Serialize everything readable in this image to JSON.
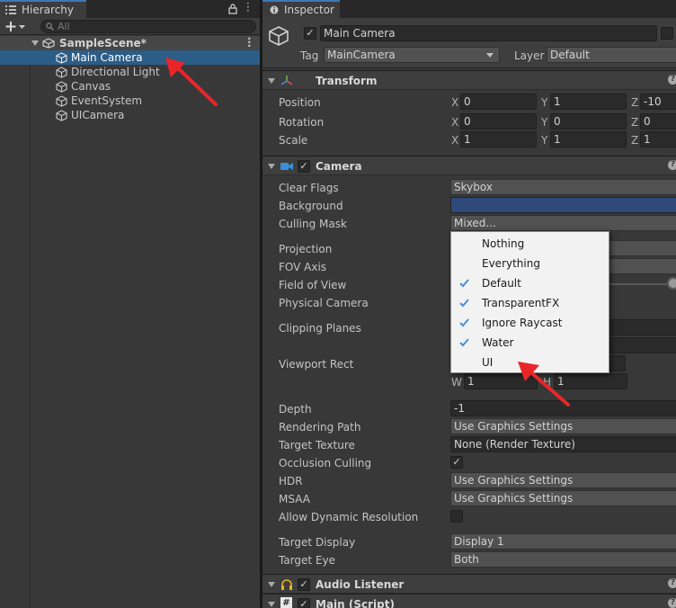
{
  "hierarchy": {
    "tab_label": "Hierarchy",
    "search_placeholder": "All",
    "scene_name": "SampleScene*",
    "items": [
      {
        "label": "Main Camera",
        "selected": true
      },
      {
        "label": "Directional Light",
        "selected": false
      },
      {
        "label": "Canvas",
        "selected": false
      },
      {
        "label": "EventSystem",
        "selected": false
      },
      {
        "label": "UICamera",
        "selected": false
      }
    ]
  },
  "inspector": {
    "tab_label": "Inspector",
    "object_name": "Main Camera",
    "tag_label": "Tag",
    "tag_value": "MainCamera",
    "layer_label": "Layer",
    "layer_value": "Default",
    "transform": {
      "title": "Transform",
      "position_label": "Position",
      "rotation_label": "Rotation",
      "scale_label": "Scale",
      "axis_x": "X",
      "axis_y": "Y",
      "axis_z": "Z",
      "position": {
        "x": "0",
        "y": "1",
        "z": "-10"
      },
      "rotation": {
        "x": "0",
        "y": "0",
        "z": "0"
      },
      "scale": {
        "x": "1",
        "y": "1",
        "z": "1"
      }
    },
    "camera": {
      "title": "Camera",
      "clear_flags_label": "Clear Flags",
      "clear_flags_value": "Skybox",
      "background_label": "Background",
      "background_color": "#2f4a7a",
      "culling_mask_label": "Culling Mask",
      "culling_mask_value": "Mixed...",
      "projection_label": "Projection",
      "fov_axis_label": "FOV Axis",
      "field_of_view_label": "Field of View",
      "physical_camera_label": "Physical Camera",
      "clipping_planes_label": "Clipping Planes",
      "viewport_rect_label": "Viewport Rect",
      "viewport_w_label": "W",
      "viewport_w_value": "1",
      "viewport_h_label": "H",
      "viewport_h_value": "1",
      "depth_label": "Depth",
      "depth_value": "-1",
      "rendering_path_label": "Rendering Path",
      "rendering_path_value": "Use Graphics Settings",
      "target_texture_label": "Target Texture",
      "target_texture_value": "None (Render Texture)",
      "occlusion_culling_label": "Occlusion Culling",
      "hdr_label": "HDR",
      "hdr_value": "Use Graphics Settings",
      "msaa_label": "MSAA",
      "msaa_value": "Use Graphics Settings",
      "allow_dynamic_resolution_label": "Allow Dynamic Resolution",
      "target_display_label": "Target Display",
      "target_display_value": "Display 1",
      "target_eye_label": "Target Eye",
      "target_eye_value": "Both"
    },
    "audio_listener_title": "Audio Listener",
    "main_script_title": "Main (Script)"
  },
  "culling_mask_popup": {
    "items": [
      {
        "label": "Nothing",
        "checked": false
      },
      {
        "label": "Everything",
        "checked": false
      },
      {
        "label": "Default",
        "checked": true
      },
      {
        "label": "TransparentFX",
        "checked": true
      },
      {
        "label": "Ignore Raycast",
        "checked": true
      },
      {
        "label": "Water",
        "checked": true
      },
      {
        "label": "UI",
        "checked": false
      }
    ]
  },
  "colors": {
    "selection": "#2c5d87",
    "accent_tab": "#3a79bb",
    "check_blue": "#4a90d9",
    "annotation_arrow": "#e8262a"
  }
}
